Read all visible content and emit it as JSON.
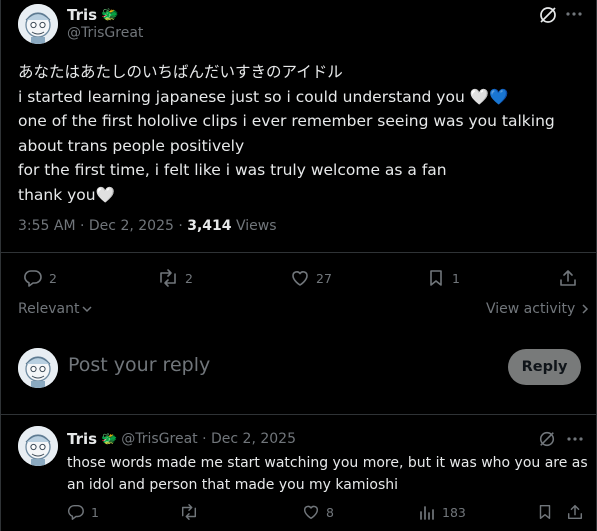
{
  "main_tweet": {
    "author_name": "Tris",
    "author_emoji": "🐲",
    "author_handle": "@TrisGreat",
    "text_lines": [
      "あなたはあたしのいちばんだいすきのアイドル",
      "i started learning japanese just so i could understand you 🤍💙",
      "one of the first hololive clips i ever remember seeing was you talking",
      "about trans people positively",
      "for the first time, i felt like i was truly welcome as a fan",
      "thank you🤍"
    ],
    "time": "3:55 AM",
    "dot": "·",
    "date": "Dec 2, 2025",
    "views_count": "3,414",
    "views_label": "Views",
    "actions": {
      "replies": "2",
      "reposts": "2",
      "likes": "27",
      "bookmarks": "1"
    }
  },
  "sort": {
    "label": "Relevant",
    "view_activity": "View activity"
  },
  "composer": {
    "placeholder": "Post your reply",
    "button": "Reply"
  },
  "reply_tweet": {
    "author_name": "Tris",
    "author_emoji": "🐲",
    "handle_date": "@TrisGreat · Dec 2, 2025",
    "text_lines": [
      "those words made me start watching you more, but it was who you are as",
      "an idol and person that made you my kamioshi"
    ],
    "actions": {
      "replies": "1",
      "reposts": "",
      "likes": "8",
      "views": "183"
    }
  },
  "colors": {
    "background": "#000000",
    "text": "#e7e9ea",
    "secondary": "#71767b",
    "separator": "#2f3336",
    "reply_button": "#787a7a"
  }
}
